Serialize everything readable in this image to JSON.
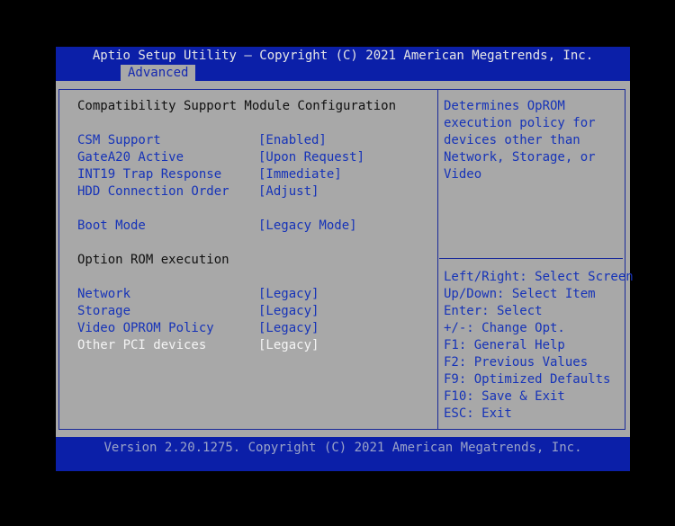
{
  "header": {
    "title": "Aptio Setup Utility – Copyright (C) 2021 American Megatrends, Inc.",
    "active_tab": "Advanced"
  },
  "page": {
    "section_title": "Compatibility Support Module Configuration",
    "option_rom_title": "Option ROM execution"
  },
  "settings": [
    {
      "label": "CSM Support",
      "value": "[Enabled]"
    },
    {
      "label": "GateA20 Active",
      "value": "[Upon Request]"
    },
    {
      "label": "INT19 Trap Response",
      "value": "[Immediate]"
    },
    {
      "label": "HDD Connection Order",
      "value": "[Adjust]"
    },
    {
      "label": "Boot Mode",
      "value": "[Legacy Mode]"
    },
    {
      "label": "Network",
      "value": "[Legacy]"
    },
    {
      "label": "Storage",
      "value": "[Legacy]"
    },
    {
      "label": "Video OPROM Policy",
      "value": "[Legacy]"
    },
    {
      "label": "Other PCI devices",
      "value": "[Legacy]"
    }
  ],
  "help": {
    "lines": [
      "Determines OpROM",
      "execution policy for",
      "devices other than",
      "Network, Storage, or",
      "Video"
    ]
  },
  "keys": [
    "Left/Right: Select Screen",
    "Up/Down: Select Item",
    "Enter: Select",
    "+/-: Change Opt.",
    "F1: General Help",
    "F2: Previous Values",
    "F9: Optimized Defaults",
    "F10: Save & Exit",
    "ESC: Exit"
  ],
  "footer": {
    "text": "Version 2.20.1275. Copyright (C) 2021 American Megatrends, Inc."
  },
  "colors": {
    "header_bg": "#0b1fa8",
    "panel_bg": "#a8a8a8",
    "item_text": "#1633b8",
    "selected_text": "#f4f4f4"
  }
}
